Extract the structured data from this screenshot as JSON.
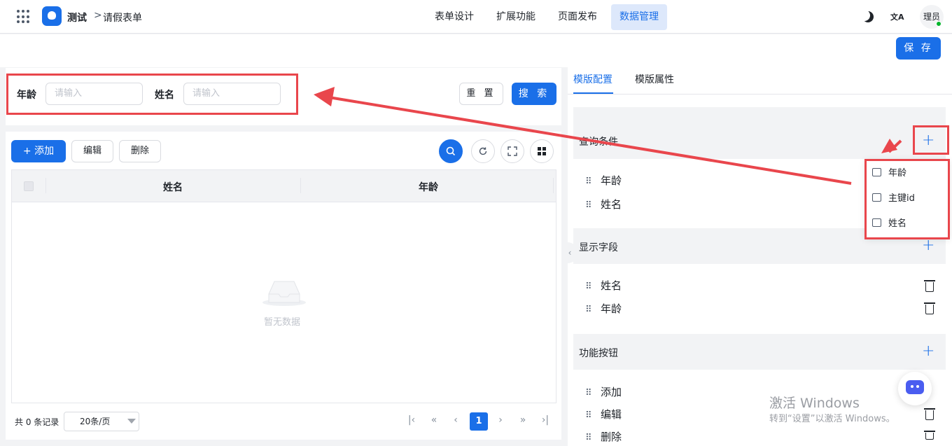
{
  "topbar": {
    "app_name": "测试",
    "breadcrumb_sep": ">",
    "breadcrumb": "请假表单",
    "nav": [
      "表单设计",
      "扩展功能",
      "页面发布",
      "数据管理"
    ],
    "lang_glyph": "文A",
    "avatar_text": "理员"
  },
  "toolbar": {
    "save_label": "保 存"
  },
  "search": {
    "fields": [
      {
        "label": "年龄",
        "placeholder": "请输入"
      },
      {
        "label": "姓名",
        "placeholder": "请输入"
      }
    ],
    "reset_label": "重 置",
    "search_label": "搜 索"
  },
  "table_toolbar": {
    "add_label": "+ 添加",
    "edit_label": "编辑",
    "delete_label": "删除"
  },
  "table": {
    "columns": [
      "姓名",
      "年龄"
    ],
    "empty_text": "暂无数据"
  },
  "pagination": {
    "total_text": "共 0 条记录",
    "page_size": "20条/页",
    "current_page": "1"
  },
  "right_panel": {
    "tabs": [
      "模版配置",
      "模版属性"
    ],
    "sections": [
      {
        "title": "查询条件",
        "items": [
          "年龄",
          "姓名"
        ]
      },
      {
        "title": "显示字段",
        "items": [
          "姓名",
          "年龄"
        ]
      },
      {
        "title": "功能按钮",
        "items": [
          "添加",
          "编辑",
          "删除"
        ]
      }
    ],
    "dropdown_items": [
      "年龄",
      "主键id",
      "姓名"
    ]
  },
  "watermark": {
    "line1": "激活 Windows",
    "line2": "转到“设置”以激活 Windows。"
  },
  "colors": {
    "primary": "#1a6fe8",
    "annotation_red": "#e9464c"
  }
}
